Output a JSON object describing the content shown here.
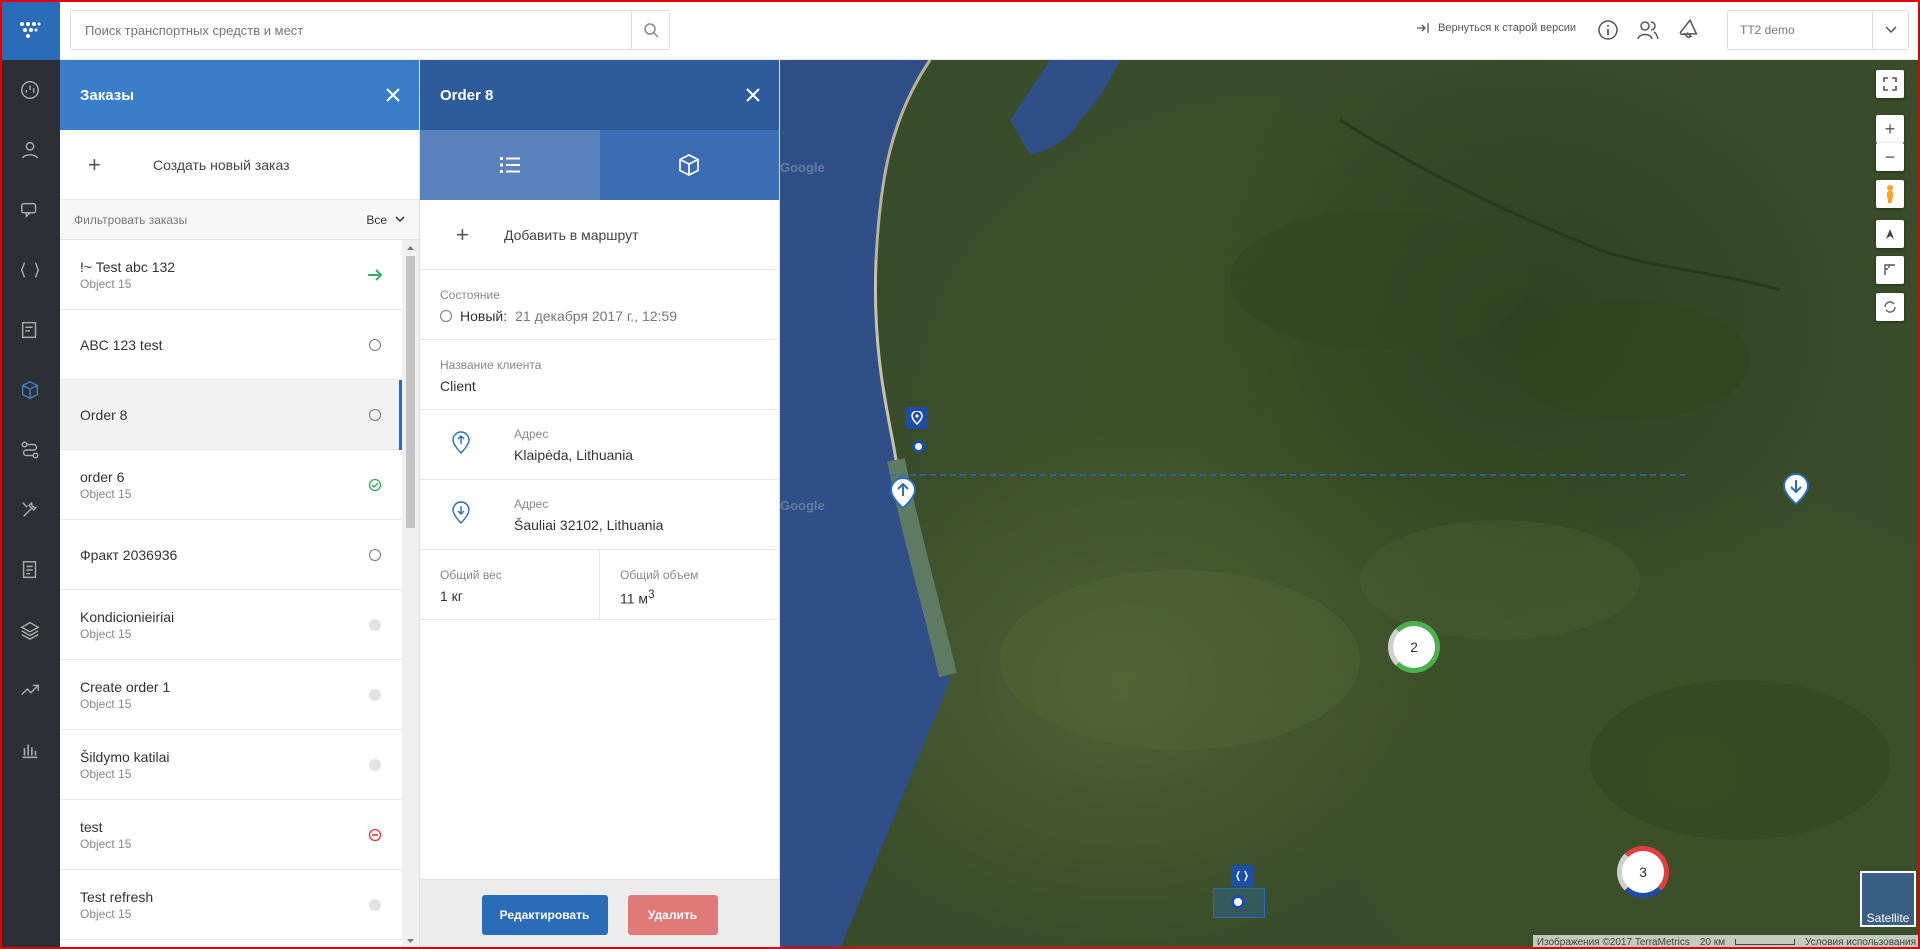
{
  "topbar": {
    "search_placeholder": "Поиск транспортных средств и мест",
    "old_version": "Вернуться к старой версии",
    "account": "TT2 demo"
  },
  "orders_panel": {
    "title": "Заказы",
    "create_label": "Создать новый заказ",
    "filter_label": "Фильтровать заказы",
    "filter_value": "Все",
    "orders": [
      {
        "title": "!~ Test abc 132",
        "sub": "Object 15",
        "status": "arrow"
      },
      {
        "title": "ABC 123 test",
        "sub": "",
        "status": "empty"
      },
      {
        "title": "Order 8",
        "sub": "",
        "status": "empty"
      },
      {
        "title": "order 6",
        "sub": "Object 15",
        "status": "done"
      },
      {
        "title": "Фракт 2036936",
        "sub": "",
        "status": "empty"
      },
      {
        "title": "Kondicionieiriai",
        "sub": "Object 15",
        "status": "grey"
      },
      {
        "title": "Create order 1",
        "sub": "Object 15",
        "status": "grey"
      },
      {
        "title": "Šildymo katilai",
        "sub": "Object 15",
        "status": "grey"
      },
      {
        "title": "test",
        "sub": "Object 15",
        "status": "cancel"
      },
      {
        "title": "Test refresh",
        "sub": "Object 15",
        "status": "grey"
      }
    ]
  },
  "detail": {
    "title": "Order 8",
    "add_route": "Добавить в маршрут",
    "state_label": "Состояние",
    "state_value": "Новый:",
    "state_date": "21 декабря 2017 г., 12:59",
    "client_label": "Название клиента",
    "client_value": "Client",
    "pickup_label": "Адрес",
    "pickup_value": "Klaipėda, Lithuania",
    "delivery_label": "Адрес",
    "delivery_value": "Šauliai 32102, Lithuania",
    "weight_label": "Общий вес",
    "weight_value": "1 кг",
    "volume_label": "Общий объем",
    "volume_value": "11 м",
    "volume_unit_sup": "3",
    "edit_button": "Редактировать",
    "delete_button": "Удалить"
  },
  "map": {
    "cluster_a": "2",
    "cluster_b": "3",
    "watermark": "Google",
    "satellite": "Satellite",
    "attribution": "Изображения ©2017 TerraMetrics",
    "scale": "20 км",
    "terms": "Условия использования"
  },
  "colors": {
    "header_blue": "#3a7dc9",
    "detail_header": "#2e5b9c",
    "nav_bg": "#2c2f33",
    "delete_red": "#e07a78"
  }
}
